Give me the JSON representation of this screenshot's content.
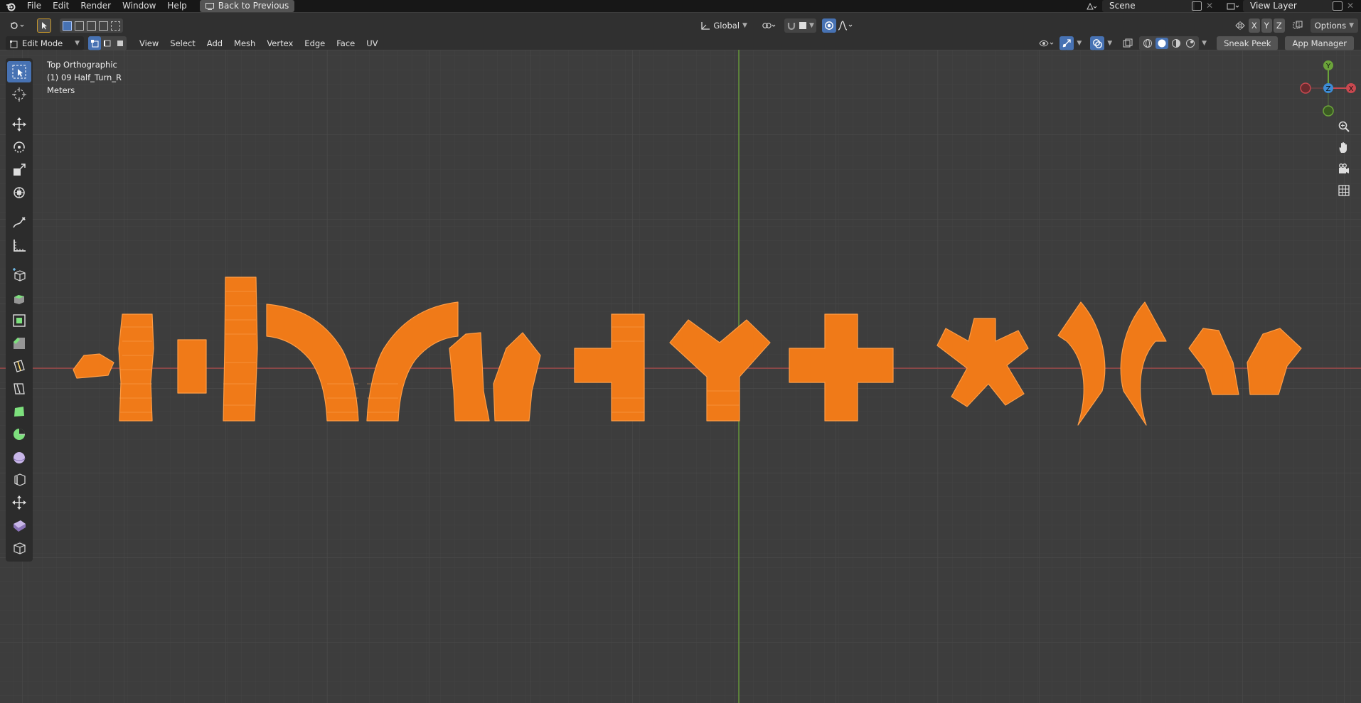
{
  "topbar": {
    "menus": [
      "File",
      "Edit",
      "Render",
      "Window",
      "Help"
    ],
    "back_label": "Back to Previous",
    "scene": "Scene",
    "view_layer": "View Layer"
  },
  "header": {
    "transform_orientation": "Global",
    "options_label": "Options",
    "axes": [
      "X",
      "Y",
      "Z"
    ]
  },
  "header2": {
    "mode": "Edit Mode",
    "menus": [
      "View",
      "Select",
      "Add",
      "Mesh",
      "Vertex",
      "Edge",
      "Face",
      "UV"
    ],
    "sneak_peek": "Sneak Peek",
    "app_manager": "App Manager"
  },
  "viewport": {
    "view_name": "Top Orthographic",
    "object_name": "(1) 09 Half_Turn_R",
    "units": "Meters"
  },
  "gizmo": {
    "y": "Y",
    "z": "Z",
    "x": "X"
  },
  "colors": {
    "mesh": "#f07a18",
    "mesh_edge": "#ffab5c",
    "x_axis": "#b34a4a",
    "y_axis": "#6ba33a",
    "accent": "#4772b3"
  }
}
